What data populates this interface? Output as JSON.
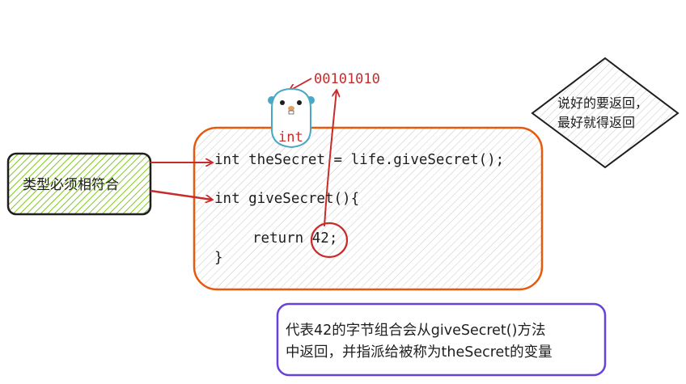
{
  "code": {
    "line1": "int theSecret = life.giveSecret();",
    "line2": "int giveSecret(){",
    "line3_prefix": "return ",
    "line3_value": "42",
    "line3_suffix": ";",
    "line4": "}"
  },
  "binary_label": "00101010",
  "gopher_type_label": "int",
  "left_note": "类型必须相符合",
  "diamond_note": {
    "line1": "说好的要返回，",
    "line2": "最好就得返回"
  },
  "bottom_note": {
    "line1": "代表42的字节组合会从giveSecret()方法",
    "line2": "中返回，并指派给被称为theSecret的变量"
  },
  "colors": {
    "code_box_stroke": "#e8590c",
    "left_box_fill": "#82c91e",
    "bottom_box_stroke": "#6741d9",
    "arrow_red": "#c92a2a",
    "gopher_blue": "#4aa8c7"
  }
}
